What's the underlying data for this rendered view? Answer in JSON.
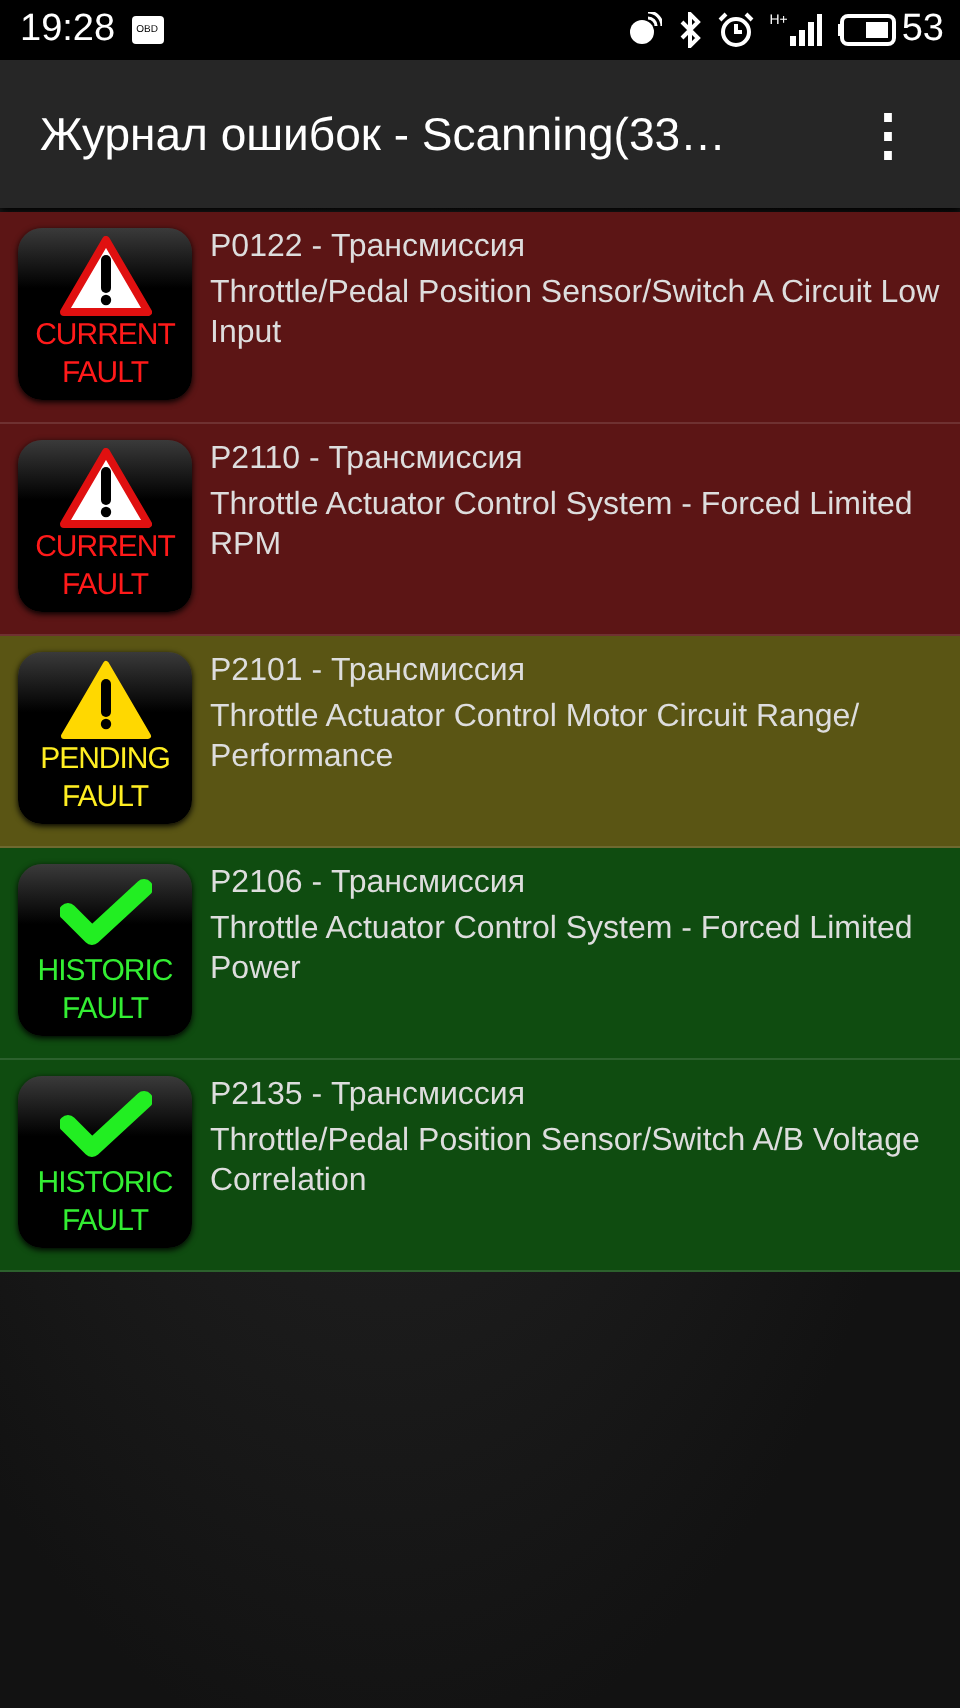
{
  "status_bar": {
    "time": "19:28",
    "app_icon_label": "OBD",
    "network": "H+",
    "battery": "53"
  },
  "app_bar": {
    "title": "Журнал ошибок - Scanning(33…",
    "menu_icon": "⋮"
  },
  "faults": [
    {
      "kind": "current",
      "badge": "CURRENT FAULT",
      "code": "P0122 - Трансмиссия",
      "description": "Throttle/Pedal Position Sensor/Switch A Circuit Low Input"
    },
    {
      "kind": "current",
      "badge": "CURRENT FAULT",
      "code": "P2110 - Трансмиссия",
      "description": "Throttle Actuator Control System - Forced Limited RPM"
    },
    {
      "kind": "pending",
      "badge": "PENDING FAULT",
      "code": "P2101 - Трансмиссия",
      "description": "Throttle Actuator Control Motor Circuit Range/ Performance"
    },
    {
      "kind": "historic",
      "badge": "HISTORIC FAULT",
      "code": "P2106 - Трансмиссия",
      "description": "Throttle Actuator Control System - Forced Limited Power"
    },
    {
      "kind": "historic",
      "badge": "HISTORIC FAULT",
      "code": "P2135 - Трансмиссия",
      "description": "Throttle/Pedal Position Sensor/Switch A/B Voltage Correlation"
    }
  ]
}
